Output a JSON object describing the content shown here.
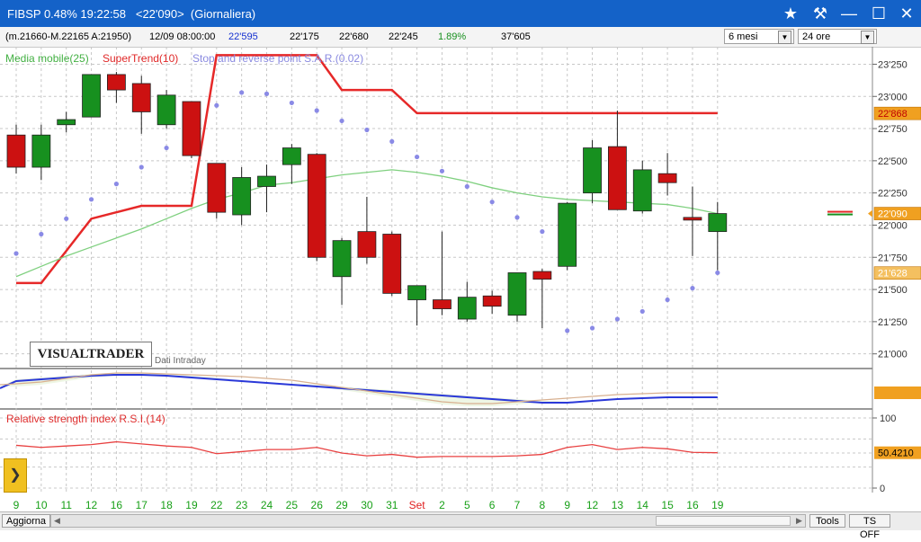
{
  "window": {
    "title": "FIBSP 0.48% 19:22:58   <22'090>  (Giornaliera)",
    "buttons": {
      "star": "★",
      "tools": "⚒",
      "minimize": "—",
      "maximize": "☐",
      "close": "✕"
    }
  },
  "infobar": {
    "range": "(m.21660-M.22165 A:21950)",
    "datetime": "12/09 08:00:00",
    "last": "22'595",
    "open": "22'175",
    "high": "22'680",
    "low": "22'245",
    "change": "1.89%",
    "volume": "37'605"
  },
  "selectors": {
    "period": "6 mesi",
    "interval": "24 ore",
    "arrow": "▼"
  },
  "legend": {
    "sma": "Media mobile(25)",
    "supertrend": "SuperTrend(10)",
    "sar": "Stop and reverse point S.A.R.(0.02)"
  },
  "logo": "VISUALTRADER",
  "intraday_label": "Dati Intraday",
  "rsi_label": "Relative strength index R.S.I.(14)",
  "bottombar": {
    "update": "Aggiorna",
    "tools": "Tools",
    "ts": "TS OFF",
    "left_arrow": "◀",
    "right_arrow": "▶",
    "expand": "❯"
  },
  "colors": {
    "up": "#17901f",
    "down": "#cc1111",
    "supertrend": "#e62828",
    "sma": "#7fd07f",
    "sar": "#8a8ae6",
    "rsi": "#e84040",
    "blue": "#2a38d8"
  },
  "chart_data": [
    {
      "type": "candlestick",
      "x": [
        "9",
        "10",
        "11",
        "12",
        "16",
        "17",
        "18",
        "19",
        "22",
        "23",
        "24",
        "25",
        "26",
        "29",
        "30",
        "31",
        "Set",
        "2",
        "5",
        "6",
        "7",
        "8",
        "9",
        "12",
        "13",
        "14",
        "15",
        "16",
        "19"
      ],
      "x_label_red": "Set",
      "y_ticks": [
        "21'000",
        "21'250",
        "21'500",
        "21'750",
        "22'000",
        "22'250",
        "22'500",
        "22'750",
        "23'000",
        "23'250"
      ],
      "ylim": [
        20900,
        23330
      ],
      "candles": [
        {
          "o": 22700,
          "h": 22780,
          "l": 22400,
          "c": 22450
        },
        {
          "o": 22450,
          "h": 22780,
          "l": 22350,
          "c": 22700
        },
        {
          "o": 22780,
          "h": 22880,
          "l": 22720,
          "c": 22820
        },
        {
          "o": 22840,
          "h": 23170,
          "l": 22840,
          "c": 23170
        },
        {
          "o": 23170,
          "h": 23190,
          "l": 22950,
          "c": 23050
        },
        {
          "o": 23100,
          "h": 23160,
          "l": 22710,
          "c": 22880
        },
        {
          "o": 22780,
          "h": 23050,
          "l": 22750,
          "c": 23010
        },
        {
          "o": 22960,
          "h": 22960,
          "l": 22520,
          "c": 22540
        },
        {
          "o": 22480,
          "h": 22480,
          "l": 22050,
          "c": 22100
        },
        {
          "o": 22080,
          "h": 22450,
          "l": 22000,
          "c": 22370
        },
        {
          "o": 22300,
          "h": 22470,
          "l": 22100,
          "c": 22380
        },
        {
          "o": 22470,
          "h": 22630,
          "l": 22320,
          "c": 22600
        },
        {
          "o": 22550,
          "h": 22560,
          "l": 21720,
          "c": 21750
        },
        {
          "o": 21600,
          "h": 21900,
          "l": 21380,
          "c": 21880
        },
        {
          "o": 21950,
          "h": 22220,
          "l": 21700,
          "c": 21750
        },
        {
          "o": 21930,
          "h": 21950,
          "l": 21450,
          "c": 21470
        },
        {
          "o": 21420,
          "h": 21530,
          "l": 21220,
          "c": 21530
        },
        {
          "o": 21420,
          "h": 21950,
          "l": 21300,
          "c": 21350
        },
        {
          "o": 21270,
          "h": 21560,
          "l": 21250,
          "c": 21440
        },
        {
          "o": 21450,
          "h": 21490,
          "l": 21310,
          "c": 21370
        },
        {
          "o": 21300,
          "h": 21630,
          "l": 21250,
          "c": 21630
        },
        {
          "o": 21640,
          "h": 21660,
          "l": 21200,
          "c": 21580
        },
        {
          "o": 21680,
          "h": 22180,
          "l": 21650,
          "c": 22170
        },
        {
          "o": 22250,
          "h": 22660,
          "l": 22170,
          "c": 22600
        },
        {
          "o": 22610,
          "h": 22890,
          "l": 22140,
          "c": 22120
        },
        {
          "o": 22110,
          "h": 22500,
          "l": 22090,
          "c": 22430
        },
        {
          "o": 22400,
          "h": 22560,
          "l": 22230,
          "c": 22330
        },
        {
          "o": 22060,
          "h": 22300,
          "l": 21760,
          "c": 22040
        },
        {
          "o": 21950,
          "h": 22180,
          "l": 21650,
          "c": 22090
        }
      ],
      "supertrend": [
        21550,
        21550,
        21800,
        22050,
        22100,
        22150,
        22150,
        22150,
        23320,
        23320,
        23320,
        23320,
        23320,
        23050,
        23050,
        23050,
        22870,
        22870,
        22870,
        22870,
        22870,
        22870,
        22870,
        22870,
        22870,
        22870,
        22870,
        22870,
        22870
      ],
      "sma": [
        21600,
        21680,
        21760,
        21830,
        21900,
        21970,
        22050,
        22130,
        22200,
        22250,
        22310,
        22330,
        22360,
        22390,
        22410,
        22430,
        22410,
        22380,
        22340,
        22290,
        22250,
        22220,
        22200,
        22190,
        22180,
        22170,
        22160,
        22130,
        22090
      ],
      "sar": [
        21780,
        21930,
        22050,
        22200,
        22320,
        22450,
        22600,
        22750,
        22930,
        23030,
        23020,
        22950,
        22890,
        22810,
        22740,
        22650,
        22530,
        22420,
        22300,
        22180,
        22060,
        21950,
        21180,
        21200,
        21270,
        21330,
        21420,
        21510,
        21630
      ],
      "price_tags": [
        {
          "label": "22'868",
          "value": 22868
        },
        {
          "label": "22'090",
          "value": 22090
        },
        {
          "label": "21'628",
          "value": 21628
        }
      ]
    },
    {
      "type": "line",
      "title": "Relative strength index R.S.I.(14)",
      "y_ticks": [
        "0",
        "100"
      ],
      "ylim": [
        0,
        100
      ],
      "values": [
        61,
        58,
        60,
        62,
        66,
        63,
        60,
        58,
        49,
        52,
        55,
        55,
        58,
        50,
        46,
        48,
        44,
        45,
        45,
        45,
        46,
        48,
        58,
        62,
        55,
        58,
        56,
        51,
        50.4
      ],
      "last_label": "50.4210"
    }
  ]
}
